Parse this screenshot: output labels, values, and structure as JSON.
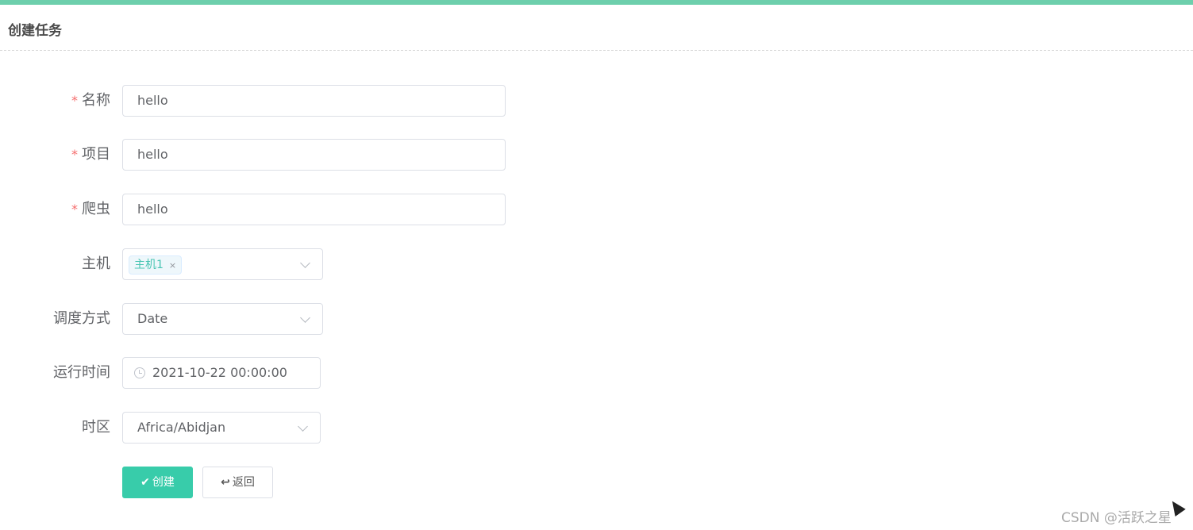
{
  "header": {
    "title": "创建任务"
  },
  "form": {
    "required_mark": "*",
    "name": {
      "label": "名称",
      "value": "hello"
    },
    "project": {
      "label": "项目",
      "value": "hello"
    },
    "spider": {
      "label": "爬虫",
      "value": "hello"
    },
    "host": {
      "label": "主机",
      "tags": [
        {
          "text": "主机1",
          "close": "×"
        }
      ]
    },
    "schedule": {
      "label": "调度方式",
      "value": "Date"
    },
    "run_time": {
      "label": "运行时间",
      "value": "2021-10-22 00:00:00"
    },
    "timezone": {
      "label": "时区",
      "value": "Africa/Abidjan"
    }
  },
  "buttons": {
    "create": {
      "icon": "check-icon",
      "glyph": "✔",
      "label": "创建"
    },
    "back": {
      "icon": "reply-icon",
      "glyph": "↩",
      "label": "返回"
    }
  },
  "watermark": "CSDN @活跃之星",
  "colors": {
    "accent": "#38ccaa",
    "top_bar": "#6dcfac",
    "required": "#f56c6c",
    "tag_text": "#49c5b3"
  }
}
